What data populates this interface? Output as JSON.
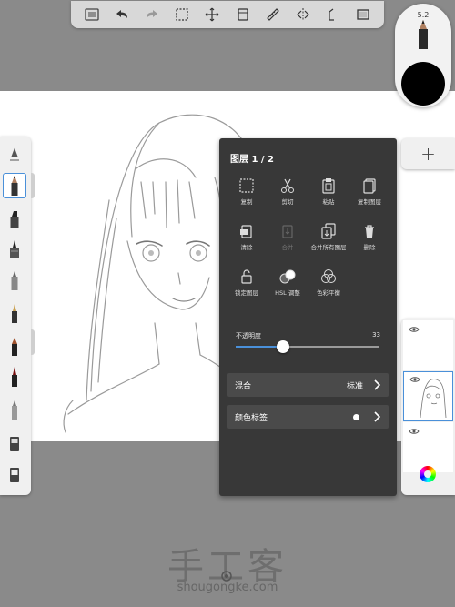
{
  "top_toolbar": {
    "icons": [
      "menu-icon",
      "undo-icon",
      "redo-icon",
      "selection-icon",
      "transform-icon",
      "layers-icon",
      "ruler-icon",
      "symmetry-icon",
      "perspective-icon",
      "fullscreen-icon"
    ]
  },
  "brush_puck": {
    "size": "5.2",
    "color": "#000000"
  },
  "brush_palette": {
    "selected_index": 1,
    "count": 11
  },
  "layer_panel": {
    "title": "图层 1 / 2",
    "actions": [
      {
        "label": "复制",
        "icon": "copy-icon",
        "enabled": true
      },
      {
        "label": "剪切",
        "icon": "cut-icon",
        "enabled": true
      },
      {
        "label": "粘贴",
        "icon": "paste-icon",
        "enabled": true
      },
      {
        "label": "复制图层",
        "icon": "duplicate-layer-icon",
        "enabled": true
      },
      {
        "label": "清除",
        "icon": "clear-icon",
        "enabled": true
      },
      {
        "label": "合并",
        "icon": "merge-icon",
        "enabled": false
      },
      {
        "label": "合并所有图层",
        "icon": "merge-all-icon",
        "enabled": true
      },
      {
        "label": "删除",
        "icon": "trash-icon",
        "enabled": true
      },
      {
        "label": "锁定图层",
        "icon": "lock-icon",
        "enabled": true
      },
      {
        "label": "HSL 调整",
        "icon": "hsl-icon",
        "enabled": true
      },
      {
        "label": "色彩平衡",
        "icon": "color-balance-icon",
        "enabled": true
      }
    ],
    "opacity": {
      "label": "不透明度",
      "value": "33",
      "fraction": 0.33
    },
    "blend": {
      "label": "混合",
      "value": "标准"
    },
    "color_label": {
      "label": "颜色标签",
      "color": "#ffffff"
    }
  },
  "layers": {
    "add_label": "+",
    "items": [
      {
        "name": "layer-top",
        "active": false
      },
      {
        "name": "layer-sketch",
        "active": true
      },
      {
        "name": "layer-background",
        "active": false
      }
    ]
  },
  "watermark": {
    "title": "手工客",
    "url": "shougongke.com"
  }
}
